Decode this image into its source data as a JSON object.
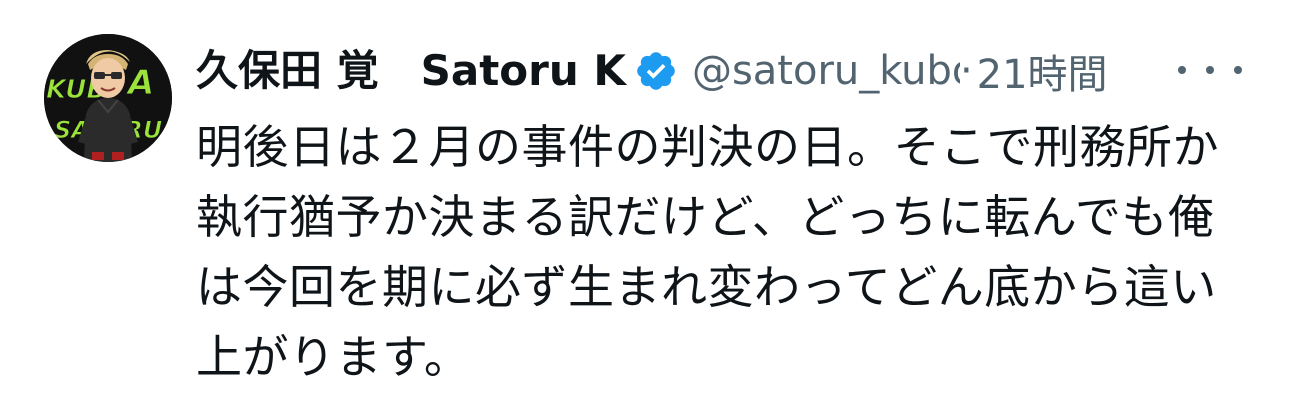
{
  "tweet": {
    "author": {
      "display_name": "久保田 覚　Satoru K",
      "handle": "@satoru_kubota",
      "verified_icon": "verified-badge-icon",
      "avatar_text_top": "KUB",
      "avatar_text_a": "A",
      "avatar_text_bottom": "SATORU"
    },
    "separator": "·",
    "timestamp": "21時間",
    "more_icon": "more-icon",
    "text_lines": [
      "明後日は２月の事件の判決の日。そこで刑務所か",
      "執行猶予か決まる訳だけど、どっちに転んでも俺",
      "は今回を期に必ず生まれ変わってどん底から這い",
      "上がります。"
    ],
    "colors": {
      "text": "#0f1419",
      "secondary": "#536471",
      "verified": "#1d9bf0",
      "avatar_bg": "#111111",
      "avatar_accent": "#9be33b"
    }
  }
}
